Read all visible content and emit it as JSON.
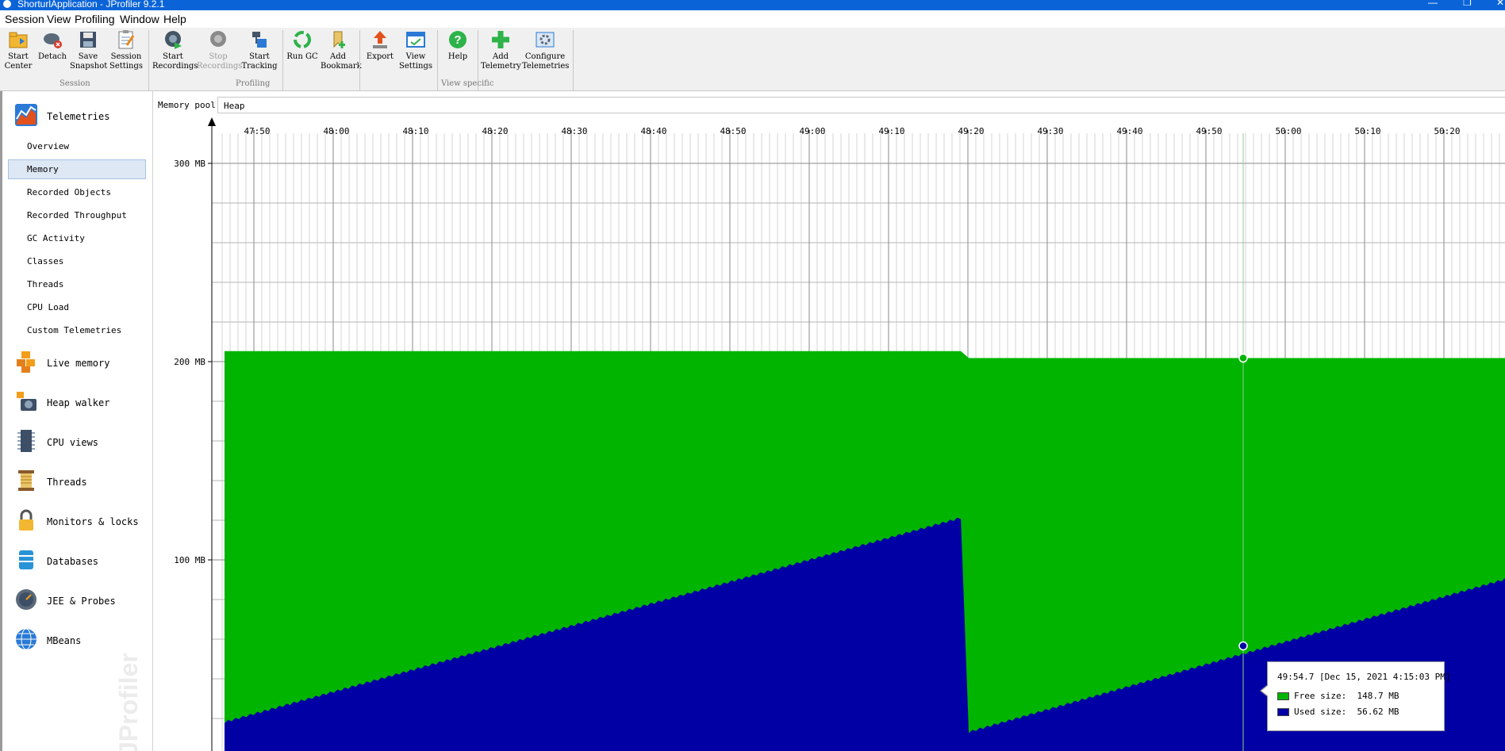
{
  "window": {
    "title": "ShorturlApplication - JProfiler 9.2.1"
  },
  "menu": [
    "Session",
    "View",
    "Profiling",
    "Window",
    "Help"
  ],
  "toolbar": {
    "buttons": [
      {
        "line1": "Start",
        "line2": "Center",
        "icon": "folder-start-icon"
      },
      {
        "line1": "Detach",
        "line2": "",
        "icon": "detach-icon"
      },
      {
        "line1": "Save",
        "line2": "Snapshot",
        "icon": "save-icon"
      },
      {
        "line1": "Session",
        "line2": "Settings",
        "icon": "clipboard-settings-icon"
      },
      {
        "line1": "Start",
        "line2": "Recordings",
        "icon": "start-recordings-icon"
      },
      {
        "line1": "Stop",
        "line2": "Recordings",
        "icon": "stop-recordings-icon"
      },
      {
        "line1": "Start",
        "line2": "Tracking",
        "icon": "tracking-icon"
      },
      {
        "line1": "Run GC",
        "line2": "",
        "icon": "recycle-icon"
      },
      {
        "line1": "Add",
        "line2": "Bookmark",
        "icon": "bookmark-icon"
      },
      {
        "line1": "Export",
        "line2": "",
        "icon": "export-icon"
      },
      {
        "line1": "View",
        "line2": "Settings",
        "icon": "view-settings-icon"
      },
      {
        "line1": "Help",
        "line2": "",
        "icon": "help-icon"
      },
      {
        "line1": "Add",
        "line2": "Telemetry",
        "icon": "add-icon"
      },
      {
        "line1": "Configure",
        "line2": "Telemetries",
        "icon": "configure-icon"
      }
    ],
    "groups": [
      "Session",
      "Profiling",
      "View specific"
    ]
  },
  "sidebar": {
    "sections": [
      {
        "label": "Telemetries",
        "icon": "telemetries-icon"
      },
      {
        "label": "Live memory",
        "icon": "live-memory-icon"
      },
      {
        "label": "Heap walker",
        "icon": "heap-walker-icon"
      },
      {
        "label": "CPU views",
        "icon": "cpu-views-icon"
      },
      {
        "label": "Threads",
        "icon": "threads-icon"
      },
      {
        "label": "Monitors & locks",
        "icon": "lock-icon"
      },
      {
        "label": "Databases",
        "icon": "database-icon"
      },
      {
        "label": "JEE & Probes",
        "icon": "probes-icon"
      },
      {
        "label": "MBeans",
        "icon": "globe-icon"
      }
    ],
    "telemetry_items": [
      "Overview",
      "Memory",
      "Recorded Objects",
      "Recorded Throughput",
      "GC Activity",
      "Classes",
      "Threads",
      "CPU Load",
      "Custom Telemetries"
    ],
    "selected_item": "Memory",
    "watermark": "JProfiler"
  },
  "memory_pool": {
    "label": "Memory pool:",
    "value": "Heap"
  },
  "chart_data": {
    "type": "area",
    "x_tick_labels": [
      "47:50",
      "48:00",
      "48:10",
      "48:20",
      "48:30",
      "48:40",
      "48:50",
      "49:00",
      "49:10",
      "49:20",
      "49:30",
      "49:40",
      "49:50",
      "50:00",
      "50:10",
      "50:20"
    ],
    "y_tick_labels": [
      "300 MB",
      "200 MB",
      "100 MB"
    ],
    "ylim_mb": [
      0,
      310
    ],
    "grid": true,
    "series": [
      {
        "name": "Free size",
        "color": "#00b400",
        "note_total_heap_mb": [
          [
            0,
            205.3
          ],
          [
            92,
            205.3
          ],
          [
            93,
            201.8
          ],
          [
            160,
            201.8
          ]
        ]
      },
      {
        "name": "Used size",
        "color": "#0000a5",
        "x_seconds": [
          0,
          92,
          93,
          160
        ],
        "values_mb": [
          18,
          121,
          13,
          90
        ]
      }
    ],
    "cursor": {
      "time": "49:54.7"
    },
    "colors": {
      "free": "#00b400",
      "used": "#0000a5"
    }
  },
  "tooltip": {
    "time": "49:54.7 [Dec 15, 2021 4:15:03 PM]",
    "free_label": "Free size:",
    "free_value": "148.7 MB",
    "used_label": "Used size:",
    "used_value": "56.62 MB"
  }
}
